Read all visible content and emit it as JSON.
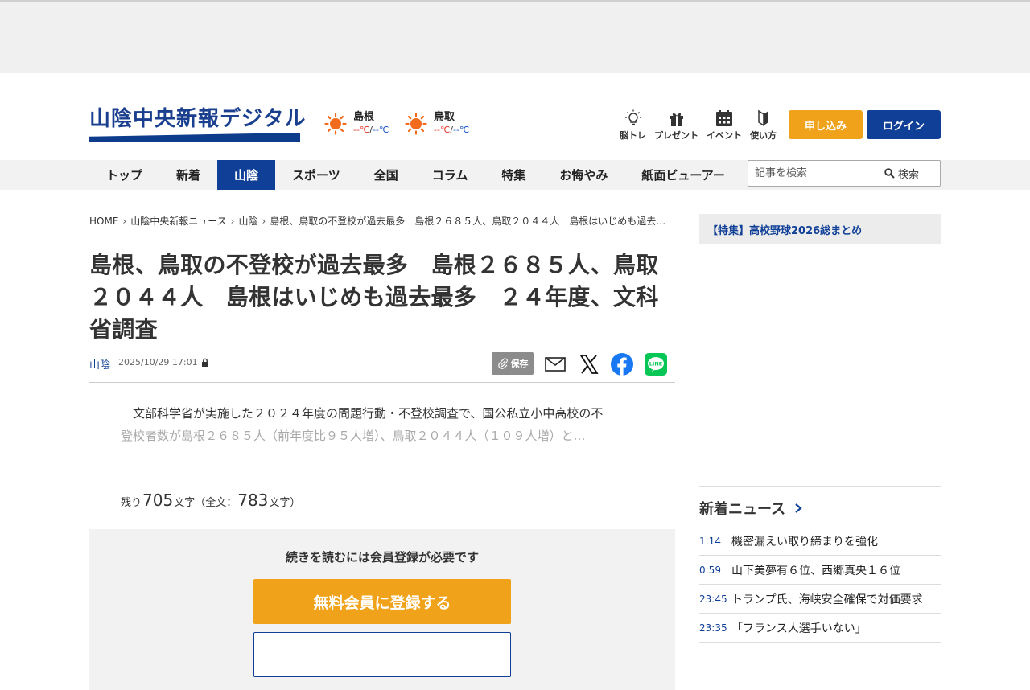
{
  "header": {
    "logo_text": "山陰中央新報デジタル",
    "weather": [
      {
        "city": "島根",
        "high": "--℃",
        "sep": "/",
        "low": "--℃",
        "icon": "sun-icon"
      },
      {
        "city": "鳥取",
        "high": "--℃",
        "sep": "/",
        "low": "--℃",
        "icon": "sun-icon"
      }
    ],
    "icons": [
      {
        "label": "脳トレ",
        "icon": "lightbulb-icon"
      },
      {
        "label": "プレゼント",
        "icon": "gift-icon"
      },
      {
        "label": "イベント",
        "icon": "calendar-icon"
      },
      {
        "label": "使い方",
        "icon": "beginner-mark-icon"
      }
    ],
    "apply_label": "申し込み",
    "login_label": "ログイン"
  },
  "nav": {
    "items": [
      "トップ",
      "新着",
      "山陰",
      "スポーツ",
      "全国",
      "コラム",
      "特集",
      "お悔やみ",
      "紙面ビューアー"
    ],
    "active": "山陰",
    "search_placeholder": "記事を検索",
    "search_label": "検索"
  },
  "breadcrumb": [
    "HOME",
    "山陰中央新報ニュース",
    "山陰",
    "島根、鳥取の不登校が過去最多　島根２６８５人、鳥取２０４４人　島根はいじめも過去最多　２４年度、文科省調査"
  ],
  "article": {
    "title": "島根、鳥取の不登校が過去最多　島根２６８５人、鳥取２０４４人　島根はいじめも過去最多　２４年度、文科省調査",
    "category": "山陰",
    "date": "2025/10/29 17:01",
    "save_label": "保存",
    "lead_line1": "文部科学省が実施した２０２４年度の問題行動・不登校調査で、国公私立小中高校の不",
    "lead_line2": "登校者数が島根２６８５人（前年度比９５人増）、鳥取２０４４人（１０９人増）と…",
    "remain_prefix": "残り",
    "remain_count": "705",
    "remain_mid": "文字（全文：",
    "total_count": "783",
    "remain_suffix": "文字）"
  },
  "paywall": {
    "text": "続きを読むには会員登録が必要です",
    "register_label": "無料会員に登録する"
  },
  "sidebar": {
    "feature_link": "【特集】高校野球2026総まとめ",
    "news_heading": "新着ニュース",
    "news": [
      {
        "time": "1:14",
        "title": "機密漏えい取り締まりを強化"
      },
      {
        "time": "0:59",
        "title": "山下美夢有６位、西郷真央１６位"
      },
      {
        "time": "23:45",
        "title": "トランプ氏、海峡安全確保で対価要求"
      },
      {
        "time": "23:35",
        "title": "「フランス人選手いない」"
      }
    ]
  },
  "colors": {
    "brand_blue": "#0f3f96",
    "accent_orange": "#f0a31a"
  }
}
